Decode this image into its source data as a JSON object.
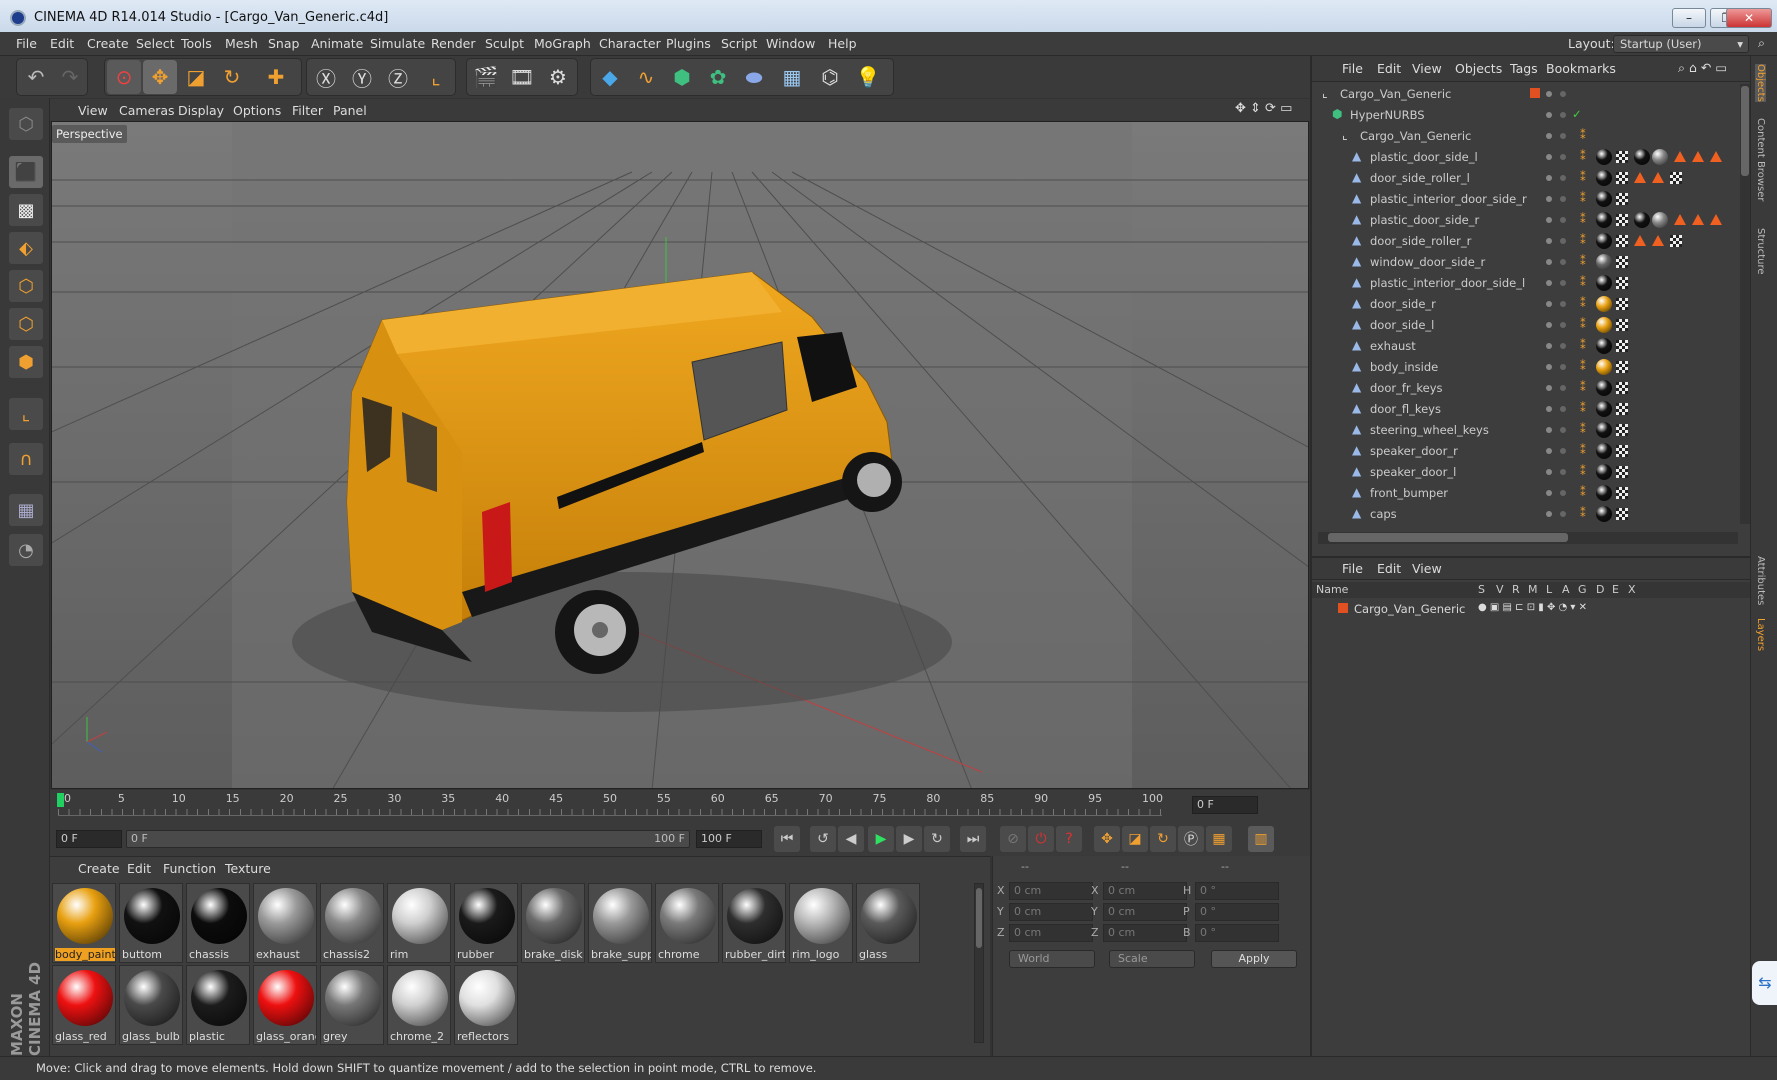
{
  "window": {
    "title": "CINEMA 4D R14.014 Studio - [Cargo_Van_Generic.c4d]",
    "controls": [
      "–",
      "❐",
      "✕"
    ]
  },
  "menubar": {
    "items": [
      "File",
      "Edit",
      "Create",
      "Select",
      "Tools",
      "Mesh",
      "Snap",
      "Animate",
      "Simulate",
      "Render",
      "Sculpt",
      "MoGraph",
      "Character",
      "Plugins",
      "Script",
      "Window",
      "Help"
    ],
    "layout_label": "Layout:",
    "layout_value": "Startup (User)"
  },
  "viewport": {
    "menu": [
      "View",
      "Cameras",
      "Display",
      "Options",
      "Filter",
      "Panel"
    ],
    "label": "Perspective"
  },
  "timeline": {
    "ticks": [
      "0",
      "5",
      "10",
      "15",
      "20",
      "25",
      "30",
      "35",
      "40",
      "45",
      "50",
      "55",
      "60",
      "65",
      "70",
      "75",
      "80",
      "85",
      "90",
      "95",
      "100"
    ],
    "current_frame": "0 F"
  },
  "transport": {
    "start": "0 F",
    "range_start": "0 F",
    "range_end": "100 F",
    "end": "100 F"
  },
  "materials": {
    "menu": [
      "Create",
      "Edit",
      "Function",
      "Texture"
    ],
    "items": [
      {
        "label": "body_paint",
        "color": "#e8a010",
        "selected": true
      },
      {
        "label": "buttom",
        "color": "#111111"
      },
      {
        "label": "chassis",
        "color": "#0c0c0c"
      },
      {
        "label": "exhaust",
        "color": "#9a9a9a"
      },
      {
        "label": "chassis2",
        "color": "#8a8a8a"
      },
      {
        "label": "rim",
        "color": "#cfcfcf"
      },
      {
        "label": "rubber",
        "color": "#1a1a1a"
      },
      {
        "label": "brake_disk",
        "color": "#6a6a6a"
      },
      {
        "label": "brake_supp",
        "color": "#999999"
      },
      {
        "label": "chrome",
        "color": "#7a7a7a"
      },
      {
        "label": "rubber_dirt",
        "color": "#2e2e2e"
      },
      {
        "label": "rim_logo",
        "color": "#b8b8b8"
      },
      {
        "label": "glass",
        "color": "#5a5a5a"
      },
      {
        "label": "glass_red",
        "color": "#ee1111"
      },
      {
        "label": "glass_bulb",
        "color": "#4a4a4a"
      },
      {
        "label": "plastic",
        "color": "#1c1c1c"
      },
      {
        "label": "glass_orang",
        "color": "#ee1010"
      },
      {
        "label": "grey",
        "color": "#777777"
      },
      {
        "label": "chrome_2",
        "color": "#d0d0d0"
      },
      {
        "label": "reflectors",
        "color": "#e0e0e0"
      }
    ]
  },
  "coords": {
    "headers": [
      "--",
      "--",
      "--"
    ],
    "rows": [
      {
        "a": "X",
        "av": "0 cm",
        "b": "X",
        "bv": "0 cm",
        "c": "H",
        "cv": "0 °"
      },
      {
        "a": "Y",
        "av": "0 cm",
        "b": "Y",
        "bv": "0 cm",
        "c": "P",
        "cv": "0 °"
      },
      {
        "a": "Z",
        "av": "0 cm",
        "b": "Z",
        "bv": "0 cm",
        "c": "B",
        "cv": "0 °"
      }
    ],
    "world": "World",
    "scale": "Scale",
    "apply": "Apply"
  },
  "status": "Move: Click and drag to move elements. Hold down SHIFT to quantize movement / add to the selection in point mode, CTRL to remove.",
  "objects": {
    "menu": [
      "File",
      "Edit",
      "View",
      "Objects",
      "Tags",
      "Bookmarks"
    ],
    "tree": [
      {
        "label": "Cargo_Van_Generic",
        "indent": 0
      },
      {
        "label": "HyperNURBS",
        "indent": 1
      },
      {
        "label": "Cargo_Van_Generic",
        "indent": 2
      },
      {
        "label": "plastic_door_side_l",
        "indent": 3
      },
      {
        "label": "door_side_roller_l",
        "indent": 3
      },
      {
        "label": "plastic_interior_door_side_r",
        "indent": 3
      },
      {
        "label": "plastic_door_side_r",
        "indent": 3
      },
      {
        "label": "door_side_roller_r",
        "indent": 3
      },
      {
        "label": "window_door_side_r",
        "indent": 3
      },
      {
        "label": "plastic_interior_door_side_l",
        "indent": 3
      },
      {
        "label": "door_side_r",
        "indent": 3
      },
      {
        "label": "door_side_l",
        "indent": 3
      },
      {
        "label": "exhaust",
        "indent": 3
      },
      {
        "label": "body_inside",
        "indent": 3
      },
      {
        "label": "door_fr_keys",
        "indent": 3
      },
      {
        "label": "door_fl_keys",
        "indent": 3
      },
      {
        "label": "steering_wheel_keys",
        "indent": 3
      },
      {
        "label": "speaker_door_r",
        "indent": 3
      },
      {
        "label": "speaker_door_l",
        "indent": 3
      },
      {
        "label": "front_bumper",
        "indent": 3
      },
      {
        "label": "caps",
        "indent": 3
      }
    ]
  },
  "layers": {
    "menu": [
      "File",
      "Edit",
      "View"
    ],
    "columns": [
      "Name",
      "S",
      "V",
      "R",
      "M",
      "L",
      "A",
      "G",
      "D",
      "E",
      "X"
    ],
    "row": "Cargo_Van_Generic"
  },
  "side_tabs": [
    "Objects",
    "Content Browser",
    "Structure",
    "Attributes",
    "Layers"
  ]
}
